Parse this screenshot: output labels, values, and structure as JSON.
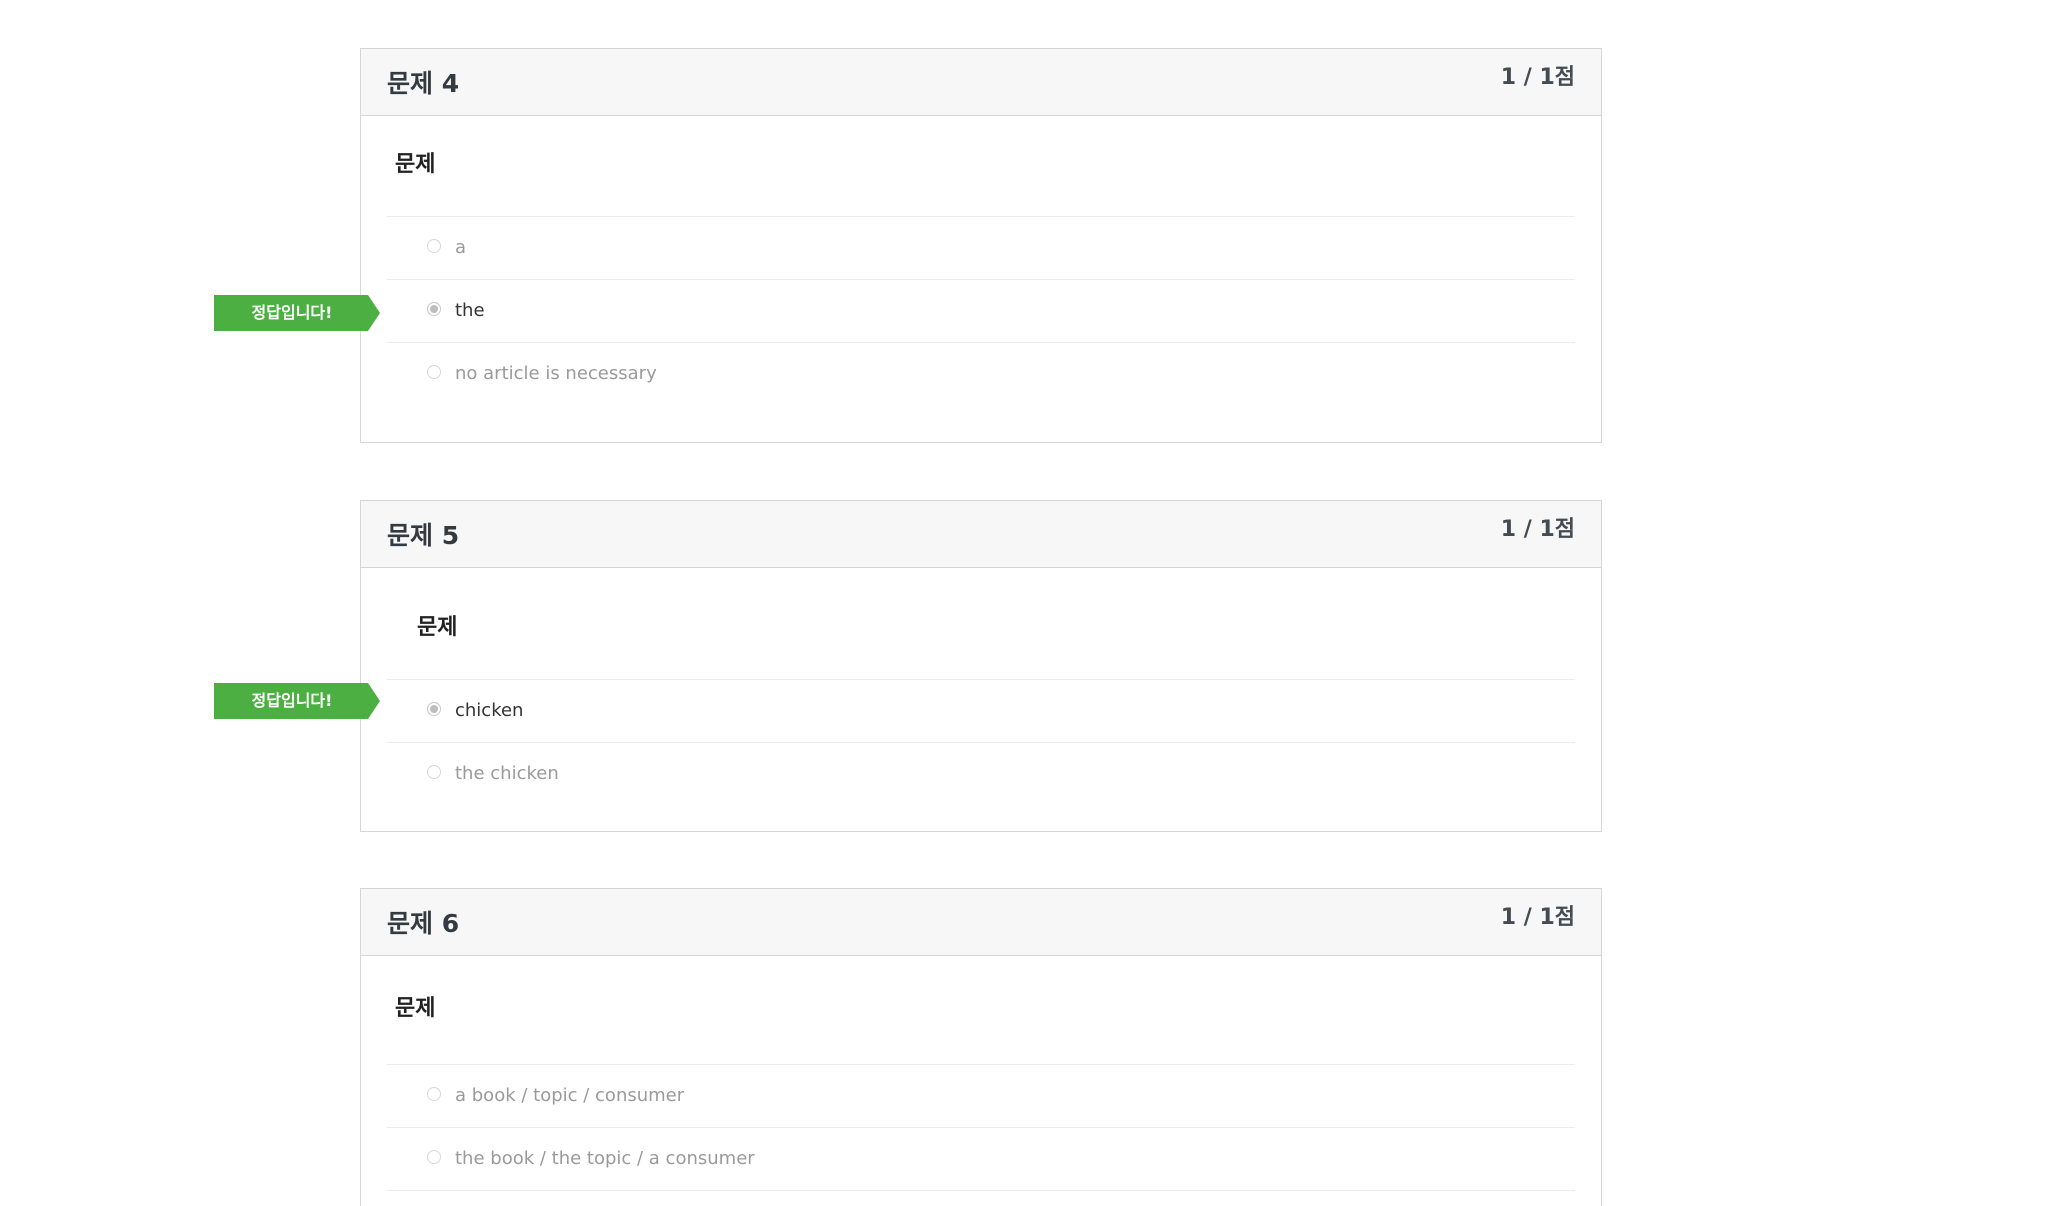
{
  "questions": [
    {
      "title": "문제 4",
      "score": "1 / 1점",
      "prompt": "문제",
      "options": [
        {
          "label": "a",
          "selected": false
        },
        {
          "label": "the",
          "selected": true
        },
        {
          "label": "no article is necessary",
          "selected": false
        }
      ],
      "badge": "정답입니다!"
    },
    {
      "title": "문제 5",
      "score": "1 / 1점",
      "prompt": "문제",
      "options": [
        {
          "label": "chicken",
          "selected": true
        },
        {
          "label": "the chicken",
          "selected": false
        }
      ],
      "badge": "정답입니다!"
    },
    {
      "title": "문제 6",
      "score": "1 / 1점",
      "prompt": "문제",
      "options": [
        {
          "label": "a book / topic / consumer",
          "selected": false
        },
        {
          "label": "the book / the topic / a consumer",
          "selected": false
        }
      ]
    }
  ],
  "colors": {
    "badge_green": "#4caf42",
    "header_bg": "#f7f7f7",
    "border": "#d6d6d6"
  }
}
